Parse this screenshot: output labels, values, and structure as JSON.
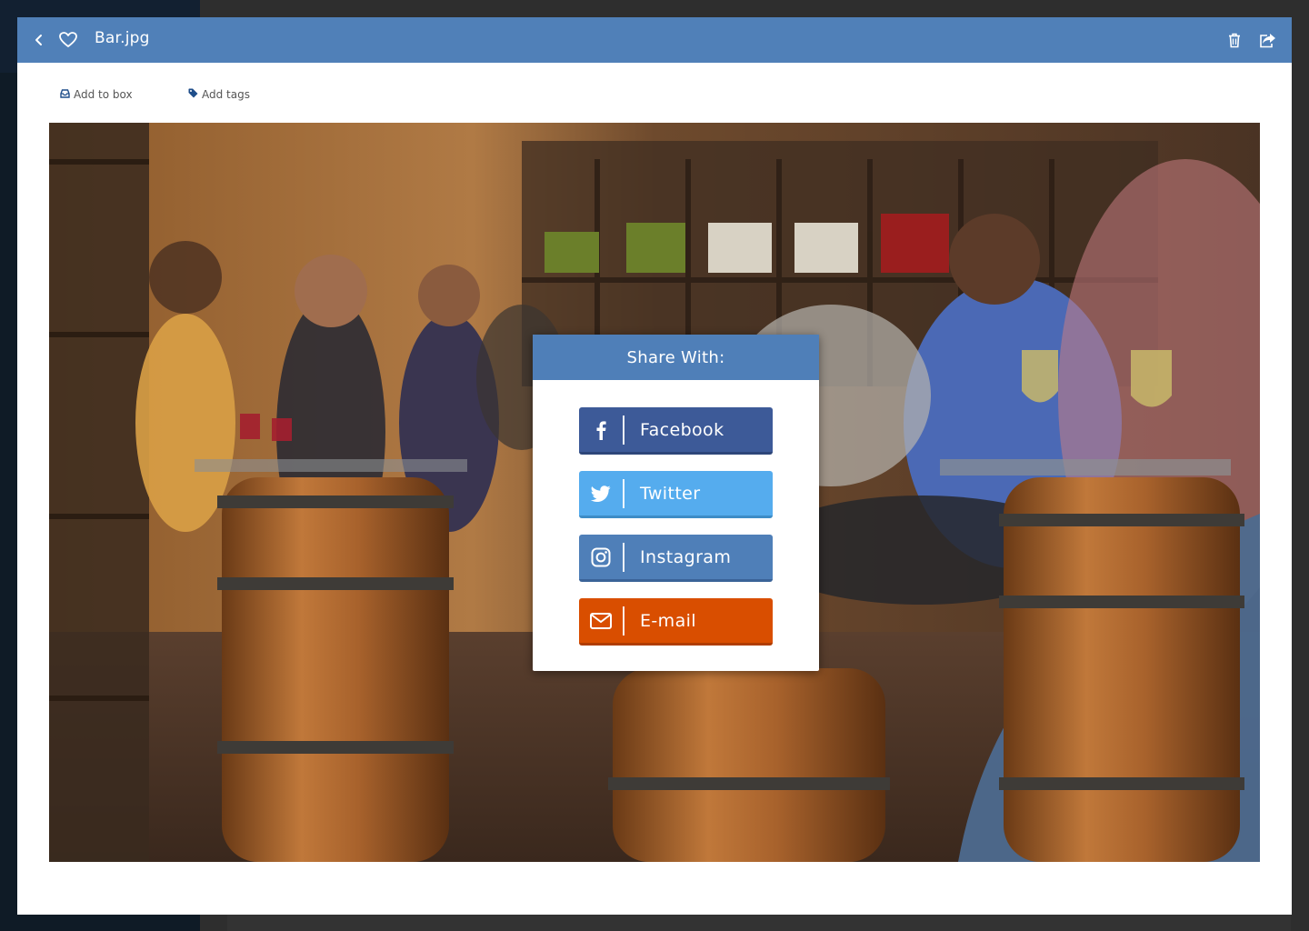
{
  "viewer": {
    "title": "Bar.jpg",
    "back_icon": "chevron-left-icon",
    "favorite_icon": "heart-icon",
    "delete_icon": "trash-icon",
    "share_icon": "share-icon"
  },
  "actions": {
    "add_to_box": "Add to box",
    "add_tags": "Add tags"
  },
  "share": {
    "heading": "Share With:",
    "buttons": [
      {
        "label": "Facebook",
        "icon": "facebook-icon",
        "color": "#3d5a98"
      },
      {
        "label": "Twitter",
        "icon": "twitter-icon",
        "color": "#55acee"
      },
      {
        "label": "Instagram",
        "icon": "instagram-icon",
        "color": "#4f7fb8"
      },
      {
        "label": "E-mail",
        "icon": "envelope-icon",
        "color": "#d94e00"
      }
    ]
  },
  "colors": {
    "topbar": "#5080b8",
    "share_header": "#4f7fb8"
  }
}
